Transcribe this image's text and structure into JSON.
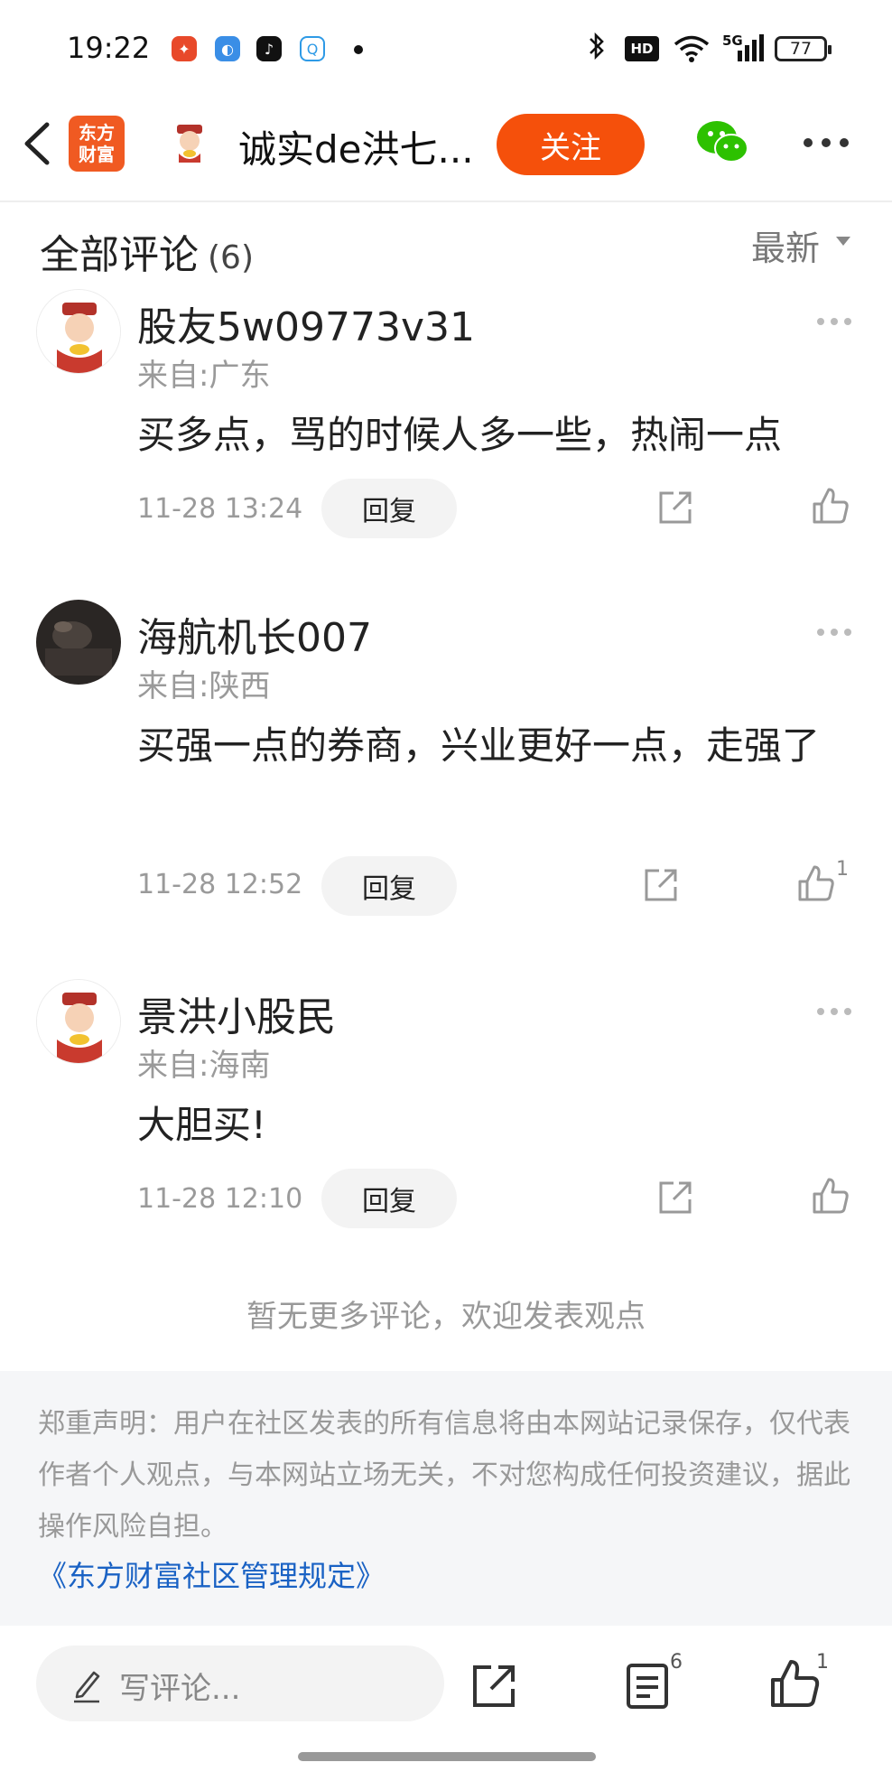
{
  "status_bar": {
    "time": "19:22",
    "network": "5G",
    "hd_badge": "HD",
    "battery": "77"
  },
  "header": {
    "logo_text": "东方财富",
    "title": "诚实de洪七...",
    "follow_label": "关注"
  },
  "section": {
    "title": "全部评论",
    "count": "(6)",
    "sort_label": "最新"
  },
  "comments": [
    {
      "name": "股友5w09773v31",
      "location": "来自:广东",
      "text": "买多点，骂的时候人多一些，热闹一点",
      "time": "11-28 13:24",
      "reply_label": "回复",
      "likes": ""
    },
    {
      "name": "海航机长007",
      "location": "来自:陕西",
      "text": "买强一点的券商，兴业更好一点，走强了",
      "time": "11-28 12:52",
      "reply_label": "回复",
      "likes": "1"
    },
    {
      "name": "景洪小股民",
      "location": "来自:海南",
      "text": "大胆买!",
      "time": "11-28 12:10",
      "reply_label": "回复",
      "likes": ""
    }
  ],
  "no_more_text": "暂无更多评论，欢迎发表观点",
  "disclaimer": {
    "text": "郑重声明：用户在社区发表的所有信息将由本网站记录保存，仅代表作者个人观点，与本网站立场无关，不对您构成任何投资建议，据此操作风险自担。",
    "link": "《东方财富社区管理规定》"
  },
  "bottom_bar": {
    "input_placeholder": "写评论...",
    "comment_count": "6",
    "like_count": "1"
  },
  "colors": {
    "accent": "#f5500b",
    "link": "#1a62c4",
    "muted": "#9a9a9a"
  }
}
